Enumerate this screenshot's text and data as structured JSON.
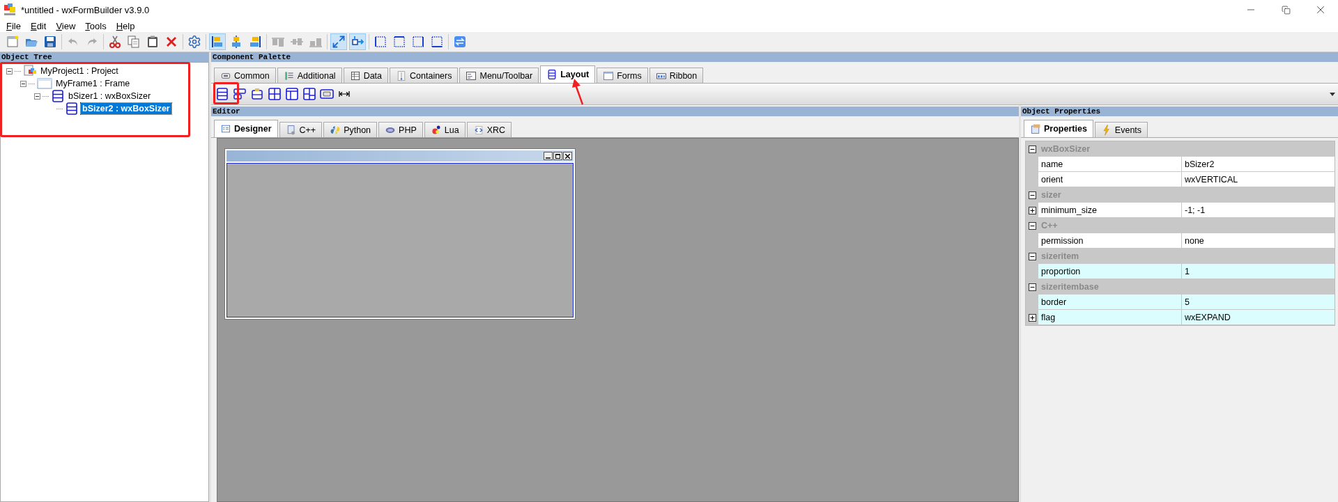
{
  "window": {
    "title": "*untitled - wxFormBuilder v3.9.0"
  },
  "menu": [
    "File",
    "Edit",
    "View",
    "Tools",
    "Help"
  ],
  "toolbar_groups": [
    {
      "items": [
        {
          "kind": "new",
          "selected": false,
          "disabled": false
        },
        {
          "kind": "open",
          "selected": false,
          "disabled": false
        },
        {
          "kind": "save",
          "selected": false,
          "disabled": false
        }
      ]
    },
    {
      "items": [
        {
          "kind": "undo",
          "selected": false,
          "disabled": true
        },
        {
          "kind": "redo",
          "selected": false,
          "disabled": true
        }
      ]
    },
    {
      "items": [
        {
          "kind": "cut",
          "selected": false,
          "disabled": false
        },
        {
          "kind": "copy",
          "selected": false,
          "disabled": false
        },
        {
          "kind": "paste",
          "selected": false,
          "disabled": false
        },
        {
          "kind": "delete",
          "selected": false,
          "disabled": false
        }
      ]
    },
    {
      "items": [
        {
          "kind": "settings",
          "selected": false,
          "disabled": false
        }
      ]
    },
    {
      "items": [
        {
          "kind": "align-left",
          "selected": true,
          "disabled": false
        },
        {
          "kind": "align-center",
          "selected": false,
          "disabled": false
        },
        {
          "kind": "align-right",
          "selected": false,
          "disabled": false
        }
      ]
    },
    {
      "items": [
        {
          "kind": "align-top",
          "selected": false,
          "disabled": true
        },
        {
          "kind": "align-middle",
          "selected": false,
          "disabled": true
        },
        {
          "kind": "align-bottom",
          "selected": false,
          "disabled": true
        }
      ]
    },
    {
      "items": [
        {
          "kind": "expand",
          "selected": true,
          "disabled": false
        },
        {
          "kind": "stretch",
          "selected": true,
          "disabled": false
        }
      ]
    },
    {
      "items": [
        {
          "kind": "border-left",
          "selected": false,
          "disabled": false
        },
        {
          "kind": "border-top",
          "selected": false,
          "disabled": false
        },
        {
          "kind": "border-right",
          "selected": false,
          "disabled": false
        },
        {
          "kind": "border-bottom",
          "selected": false,
          "disabled": false
        }
      ]
    },
    {
      "items": [
        {
          "kind": "swap",
          "selected": false,
          "disabled": false
        }
      ]
    }
  ],
  "object_tree": {
    "title": "Object Tree",
    "nodes": [
      {
        "label": "MyProject1 : Project",
        "kind": "project",
        "expanded": true,
        "selected": false,
        "children": [
          {
            "label": "MyFrame1 : Frame",
            "kind": "frame",
            "expanded": true,
            "selected": false,
            "children": [
              {
                "label": "bSizer1 : wxBoxSizer",
                "kind": "sizer",
                "expanded": true,
                "selected": false,
                "children": [
                  {
                    "label": "bSizer2 : wxBoxSizer",
                    "kind": "sizer",
                    "selected": true
                  }
                ]
              }
            ]
          }
        ]
      }
    ]
  },
  "component_palette": {
    "title": "Component Palette",
    "tabs": [
      {
        "label": "Common",
        "selected": false
      },
      {
        "label": "Additional",
        "selected": false
      },
      {
        "label": "Data",
        "selected": false
      },
      {
        "label": "Containers",
        "selected": false
      },
      {
        "label": "Menu/Toolbar",
        "selected": false
      },
      {
        "label": "Layout",
        "selected": true
      },
      {
        "label": "Forms",
        "selected": false
      },
      {
        "label": "Ribbon",
        "selected": false
      }
    ],
    "items": [
      {
        "kind": "box-sizer"
      },
      {
        "kind": "wrap-sizer"
      },
      {
        "kind": "static-box-sizer"
      },
      {
        "kind": "grid-sizer"
      },
      {
        "kind": "flex-grid-sizer"
      },
      {
        "kind": "grid-bag-sizer"
      },
      {
        "kind": "button-sizer"
      },
      {
        "kind": "spacer"
      }
    ]
  },
  "editor": {
    "title": "Editor",
    "tabs": [
      {
        "label": "Designer",
        "selected": true
      },
      {
        "label": "C++",
        "selected": false
      },
      {
        "label": "Python",
        "selected": false
      },
      {
        "label": "PHP",
        "selected": false
      },
      {
        "label": "Lua",
        "selected": false
      },
      {
        "label": "XRC",
        "selected": false
      }
    ]
  },
  "object_properties": {
    "title": "Object Properties",
    "tabs": [
      {
        "label": "Properties",
        "selected": true
      },
      {
        "label": "Events",
        "selected": false
      }
    ],
    "categories": [
      {
        "name": "wxBoxSizer",
        "expanded": true,
        "rows": [
          {
            "name": "name",
            "value": "bSizer2",
            "expandable": false,
            "highlighted": false
          },
          {
            "name": "orient",
            "value": "wxVERTICAL",
            "expandable": false,
            "highlighted": false
          }
        ]
      },
      {
        "name": "sizer",
        "expanded": true,
        "rows": [
          {
            "name": "minimum_size",
            "value": "-1; -1",
            "expandable": true,
            "highlighted": false
          }
        ]
      },
      {
        "name": "C++",
        "expanded": true,
        "rows": [
          {
            "name": "permission",
            "value": "none",
            "expandable": false,
            "highlighted": false
          }
        ]
      },
      {
        "name": "sizeritem",
        "expanded": true,
        "rows": [
          {
            "name": "proportion",
            "value": "1",
            "expandable": false,
            "highlighted": true
          }
        ]
      },
      {
        "name": "sizeritembase",
        "expanded": true,
        "rows": [
          {
            "name": "border",
            "value": "5",
            "expandable": false,
            "highlighted": true
          },
          {
            "name": "flag",
            "value": "wxEXPAND",
            "expandable": true,
            "highlighted": true
          }
        ]
      }
    ]
  }
}
